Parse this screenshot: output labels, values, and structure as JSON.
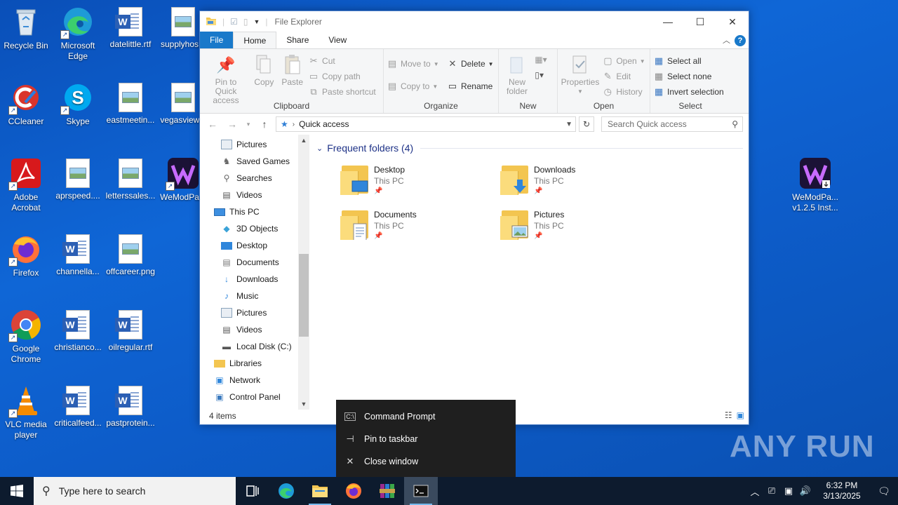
{
  "desktop": {
    "icons": [
      {
        "label": "Recycle Bin"
      },
      {
        "label": "Microsoft Edge"
      },
      {
        "label": "datelittle.rtf"
      },
      {
        "label": "supplyhos..."
      },
      {
        "label": "CCleaner"
      },
      {
        "label": "Skype"
      },
      {
        "label": "eastmeetin..."
      },
      {
        "label": "vegasview..."
      },
      {
        "label": "Adobe Acrobat"
      },
      {
        "label": "aprspeed...."
      },
      {
        "label": "letterssales..."
      },
      {
        "label": "WeModPa..."
      },
      {
        "label": "Firefox"
      },
      {
        "label": "channella..."
      },
      {
        "label": "offcareer.png"
      },
      {
        "label": "Google Chrome"
      },
      {
        "label": "christianco..."
      },
      {
        "label": "oilregular.rtf"
      },
      {
        "label": "VLC media player"
      },
      {
        "label": "criticalfeed..."
      },
      {
        "label": "pastprotein..."
      },
      {
        "label": "WeModPa... v1.2.5 Inst..."
      }
    ]
  },
  "explorer": {
    "title": "File Explorer",
    "tabs": {
      "file": "File",
      "home": "Home",
      "share": "Share",
      "view": "View"
    },
    "ribbon": {
      "clipboard": {
        "name": "Clipboard",
        "pin": "Pin to Quick access",
        "copy": "Copy",
        "paste": "Paste",
        "cut": "Cut",
        "copy_path": "Copy path",
        "paste_shortcut": "Paste shortcut"
      },
      "organize": {
        "name": "Organize",
        "move_to": "Move to",
        "copy_to": "Copy to",
        "delete": "Delete",
        "rename": "Rename"
      },
      "new": {
        "name": "New",
        "new_folder": "New folder"
      },
      "open": {
        "name": "Open",
        "properties": "Properties",
        "open": "Open",
        "edit": "Edit",
        "history": "History"
      },
      "select": {
        "name": "Select",
        "select_all": "Select all",
        "select_none": "Select none",
        "invert": "Invert selection"
      }
    },
    "address": {
      "path": "Quick access",
      "search_placeholder": "Search Quick access"
    },
    "nav": [
      {
        "label": "Pictures",
        "icon": "pictures-icon"
      },
      {
        "label": "Saved Games",
        "icon": "saved-games-icon"
      },
      {
        "label": "Searches",
        "icon": "searches-icon"
      },
      {
        "label": "Videos",
        "icon": "videos-icon"
      },
      {
        "label": "This PC",
        "icon": "this-pc-icon"
      },
      {
        "label": "3D Objects",
        "icon": "3d-objects-icon"
      },
      {
        "label": "Desktop",
        "icon": "desktop-icon"
      },
      {
        "label": "Documents",
        "icon": "documents-icon"
      },
      {
        "label": "Downloads",
        "icon": "downloads-icon"
      },
      {
        "label": "Music",
        "icon": "music-icon"
      },
      {
        "label": "Pictures",
        "icon": "pictures-icon"
      },
      {
        "label": "Videos",
        "icon": "videos-icon"
      },
      {
        "label": "Local Disk (C:)",
        "icon": "disk-icon"
      },
      {
        "label": "Libraries",
        "icon": "libraries-icon"
      },
      {
        "label": "Network",
        "icon": "network-icon"
      },
      {
        "label": "Control Panel",
        "icon": "control-panel-icon"
      }
    ],
    "section": "Frequent folders (4)",
    "folders": [
      {
        "name": "Desktop",
        "location": "This PC"
      },
      {
        "name": "Downloads",
        "location": "This PC"
      },
      {
        "name": "Documents",
        "location": "This PC"
      },
      {
        "name": "Pictures",
        "location": "This PC"
      }
    ],
    "status": "4 items"
  },
  "jumplist": {
    "items": [
      {
        "label": "Command Prompt",
        "icon": "cmd-icon"
      },
      {
        "label": "Pin to taskbar",
        "icon": "pin-icon"
      },
      {
        "label": "Close window",
        "icon": "close-icon"
      }
    ]
  },
  "watermark": "ANY RUN",
  "taskbar": {
    "search_placeholder": "Type here to search",
    "time": "6:32 PM",
    "date": "3/13/2025"
  },
  "colors": {
    "accent": "#1979ca",
    "desktop": "#0f66d6",
    "taskbar": "#0d1b2e"
  }
}
